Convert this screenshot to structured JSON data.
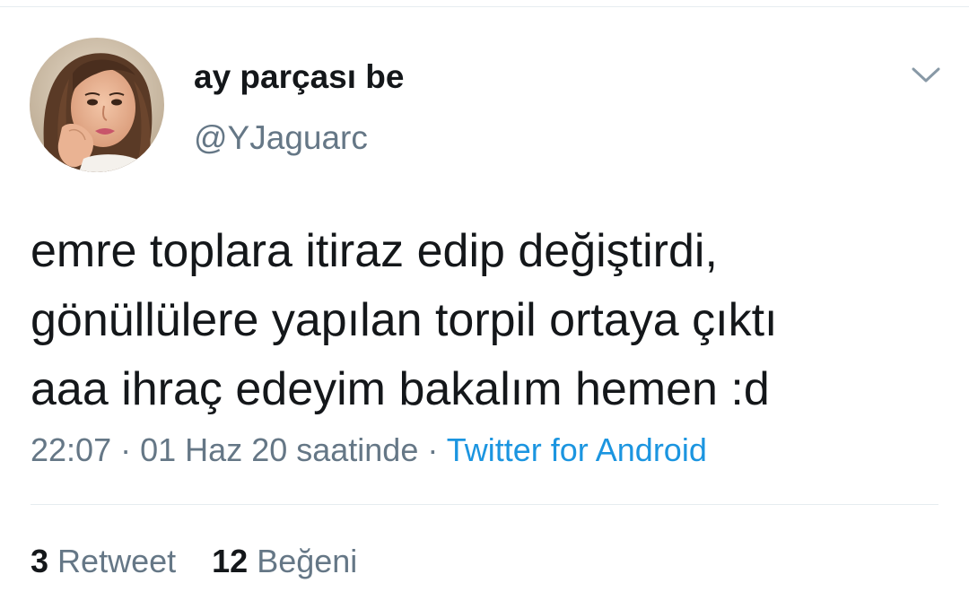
{
  "user": {
    "display_name": "ay parçası be",
    "handle": "@YJaguarc"
  },
  "tweet": {
    "lines": [
      "emre toplara itiraz edip değiştirdi,",
      "gönüllülere yapılan torpil ortaya çıktı",
      "aaa ihraç edeyim bakalım hemen :d"
    ],
    "time": "22:07",
    "date": "01 Haz 20 saatinde",
    "separator": "·",
    "source": "Twitter for Android"
  },
  "stats": {
    "retweets": {
      "count": "3",
      "label": "Retweet"
    },
    "likes": {
      "count": "12",
      "label": "Beğeni"
    }
  },
  "colors": {
    "text": "#14171a",
    "secondary": "#657786",
    "link": "#1b95e0",
    "divider": "#e6ecf0"
  },
  "icons": {
    "more": "chevron-down-icon"
  }
}
